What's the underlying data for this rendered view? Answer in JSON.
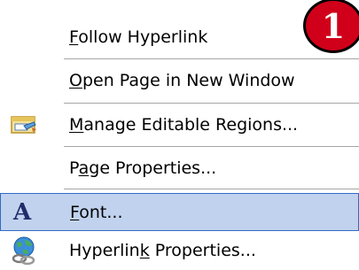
{
  "menu": {
    "items": [
      {
        "pre": "",
        "mnemonic": "F",
        "post": "ollow Hyperlink",
        "icon": "none",
        "selected": false
      },
      {
        "pre": "",
        "mnemonic": "O",
        "post": "pen Page in New Window",
        "icon": "none",
        "selected": false
      },
      {
        "pre": "",
        "mnemonic": "M",
        "post": "anage Editable Regions...",
        "icon": "editable-regions-icon",
        "selected": false
      },
      {
        "pre": "P",
        "mnemonic": "a",
        "post": "ge Properties...",
        "icon": "none",
        "selected": false
      },
      {
        "pre": "",
        "mnemonic": "F",
        "post": "ont...",
        "icon": "font-icon",
        "icon_text": "A",
        "selected": true
      },
      {
        "pre": "Hyperlin",
        "mnemonic": "k",
        "post": " Properties...",
        "icon": "hyperlink-globe-icon",
        "selected": false
      }
    ]
  },
  "badge": {
    "text": "1",
    "color": "#d0001a"
  },
  "colors": {
    "selection_fill": "#c1d2ee",
    "selection_border": "#316ac5"
  }
}
